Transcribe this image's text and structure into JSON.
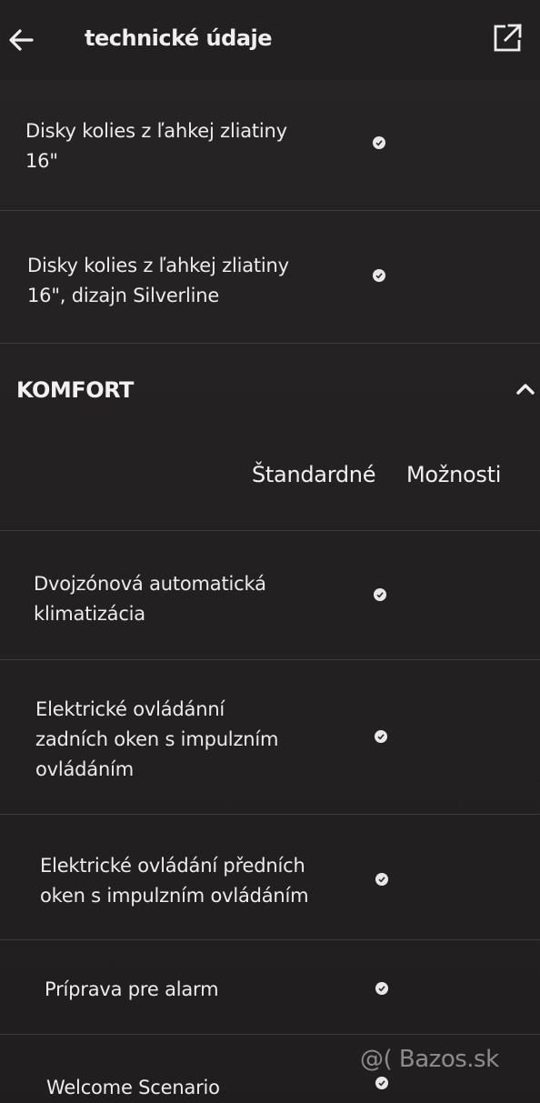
{
  "header": {
    "title": "technické údaje",
    "back_icon": "arrow-left-icon",
    "share_icon": "external-link-icon"
  },
  "rows_top": [
    {
      "label": "Disky kolies z ľahkej zliatiny\n16\"",
      "standard": true
    },
    {
      "label": "Disky kolies z ľahkej zliatiny\n16\", dizajn Silverline",
      "standard": true
    }
  ],
  "section": {
    "title": "KOMFORT",
    "collapse_icon": "chevron-up-icon",
    "columns": {
      "standard": "Štandardné",
      "options": "Možnosti"
    }
  },
  "rows_komfort": [
    {
      "label": "Dvojzónová automatická\nklimatizácia",
      "standard": true
    },
    {
      "label": "Elektrické ovládánní\nzadních oken s impulzním\novládáním",
      "standard": true
    },
    {
      "label": "Elektrické ovládání předních\noken s impulzním ovládáním",
      "standard": true
    },
    {
      "label": "Príprava pre alarm",
      "standard": true
    },
    {
      "label": "Welcome Scenario",
      "standard": true
    }
  ],
  "watermark": "@( Bazos.sk",
  "colors": {
    "background": "#221f1f",
    "text": "#ececec",
    "divider": "#3e3b3b",
    "check": "#e8e8e8"
  }
}
